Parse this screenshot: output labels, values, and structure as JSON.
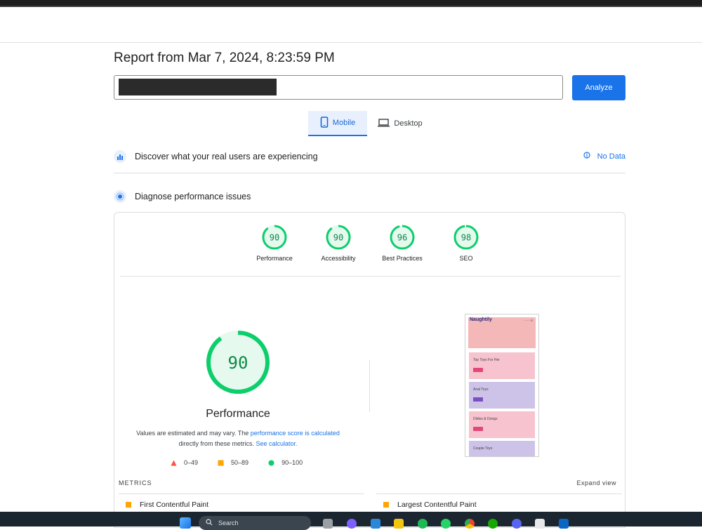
{
  "report": {
    "title": "Report from Mar 7, 2024, 8:23:59 PM"
  },
  "url_input": {
    "value": ""
  },
  "analyze_label": "Analyze",
  "tabs": [
    {
      "label": "Mobile",
      "active": true
    },
    {
      "label": "Desktop",
      "active": false
    }
  ],
  "real_users": {
    "label": "Discover what your real users are experiencing",
    "status": "No Data"
  },
  "diagnose": {
    "label": "Diagnose performance issues"
  },
  "scores": [
    {
      "label": "Performance",
      "value": 90
    },
    {
      "label": "Accessibility",
      "value": 90
    },
    {
      "label": "Best Practices",
      "value": 96
    },
    {
      "label": "SEO",
      "value": 98
    }
  ],
  "main_score": {
    "value": "90",
    "title": "Performance"
  },
  "description": {
    "part1": "Values are estimated and may vary. The ",
    "link1": "performance score is calculated",
    "part2": " directly from these metrics. ",
    "link2": "See calculator."
  },
  "legend": [
    "0–49",
    "50–89",
    "90–100"
  ],
  "metrics": {
    "heading": "METRICS",
    "expand": "Expand view",
    "items": [
      {
        "label": "First Contentful Paint"
      },
      {
        "label": "Largest Contentful Paint"
      }
    ]
  },
  "phone_preview": {
    "brand": "Naughtily",
    "cards": [
      "Top Toys For Her",
      "Anal Toys",
      "Dildos & Dongs",
      "Couple Toys"
    ]
  },
  "taskbar": {
    "search": "Search"
  },
  "colors": {
    "pass": "#0cce6b",
    "average": "#ffa400",
    "fail": "#ff4e42",
    "accent": "#1a73e8"
  }
}
